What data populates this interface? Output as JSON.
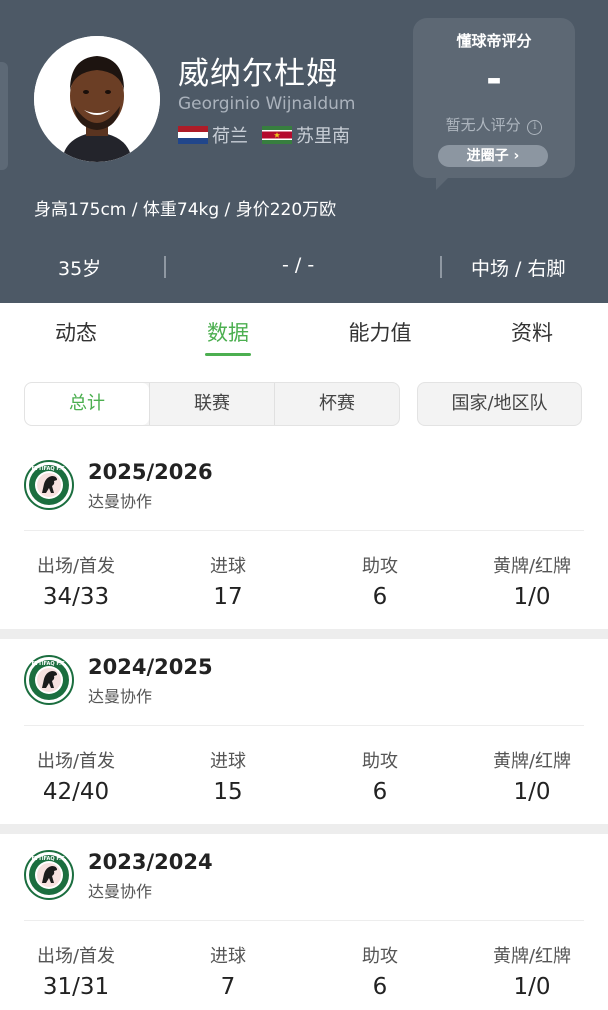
{
  "player": {
    "name_cn": "威纳尔杜姆",
    "name_en": "Georginio Wijnaldum",
    "nationalities": [
      {
        "label": "荷兰",
        "flag": "netherlands-flag"
      },
      {
        "label": "苏里南",
        "flag": "suriname-flag"
      }
    ],
    "body_info": "身高175cm / 体重74kg / 身价220万欧",
    "summary": {
      "age": "35岁",
      "number": "- / -",
      "position": "中场 / 右脚"
    }
  },
  "rating": {
    "title": "懂球帝评分",
    "value": "-",
    "none_text": "暂无人评分",
    "info_icon": "ⓘ",
    "button_label": "进圈子",
    "button_icon": "›"
  },
  "tabs": [
    {
      "label": "动态",
      "active": false
    },
    {
      "label": "数据",
      "active": true
    },
    {
      "label": "能力值",
      "active": false
    },
    {
      "label": "资料",
      "active": false
    }
  ],
  "filters": {
    "segments": [
      {
        "label": "总计",
        "active": true
      },
      {
        "label": "联赛",
        "active": false
      },
      {
        "label": "杯赛",
        "active": false
      }
    ],
    "national": "国家/地区队"
  },
  "stat_labels": [
    "出场/首发",
    "进球",
    "助攻",
    "黄牌/红牌"
  ],
  "seasons": [
    {
      "year": "2025/2026",
      "club": "达曼协作",
      "stats": [
        "34/33",
        "17",
        "6",
        "1/0"
      ]
    },
    {
      "year": "2024/2025",
      "club": "达曼协作",
      "stats": [
        "42/40",
        "15",
        "6",
        "1/0"
      ]
    },
    {
      "year": "2023/2024",
      "club": "达曼协作",
      "stats": [
        "31/31",
        "7",
        "6",
        "1/0"
      ]
    }
  ],
  "colors": {
    "header_bg": "#4d5966",
    "accent": "#4caf50",
    "club_green": "#1b6e3f"
  }
}
